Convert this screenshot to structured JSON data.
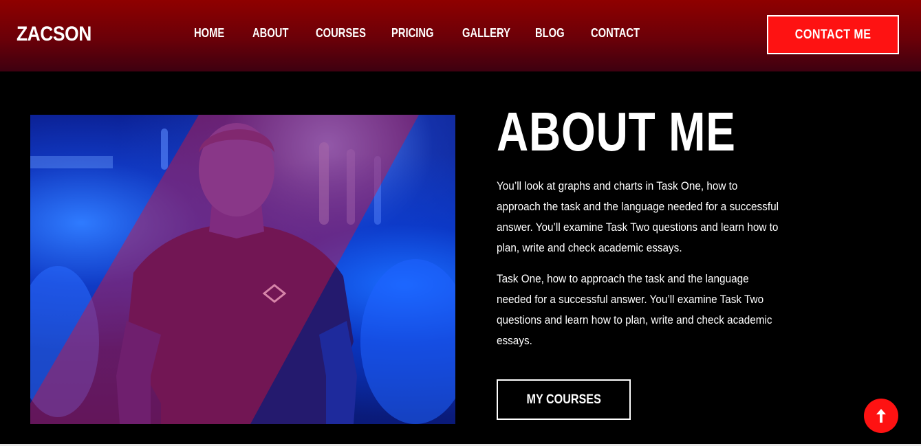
{
  "header": {
    "logo": "ZACSON",
    "nav": [
      {
        "label": "HOME"
      },
      {
        "label": "ABOUT"
      },
      {
        "label": "COURSES"
      },
      {
        "label": "PRICING"
      },
      {
        "label": "GALLERY"
      },
      {
        "label": "BLOG"
      },
      {
        "label": "CONTACT"
      }
    ],
    "cta_label": "CONTACT ME"
  },
  "about": {
    "title": "ABOUT ME",
    "paragraph_1": "You’ll look at graphs and charts in Task One, how to approach the task and the language needed for a successful answer. You’ll examine Task Two questions and learn how to plan, write and check academic essays.",
    "paragraph_2": "Task One, how to approach the task and the language needed for a successful answer. You’ll examine Task Two questions and learn how to plan, write and check academic essays.",
    "button_label": "MY COURSES"
  },
  "icons": {
    "scroll_top": "arrow-up-icon"
  },
  "colors": {
    "accent": "#fe1212",
    "header_top": "#8f0000",
    "header_bottom": "#3e0010",
    "background": "#000000",
    "photo_tint": "#1f4bd8"
  }
}
